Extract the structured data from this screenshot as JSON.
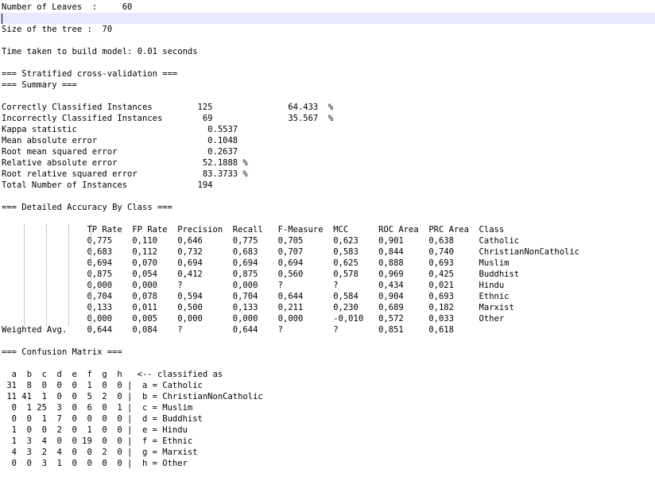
{
  "output": {
    "lines": [
      "Number of Leaves  :     60",
      "",
      "Size of the tree :  70",
      "",
      "Time taken to build model: 0.01 seconds",
      "",
      "=== Stratified cross-validation ===",
      "=== Summary ===",
      "",
      "Correctly Classified Instances         125               64.433  %",
      "Incorrectly Classified Instances        69               35.567  %",
      "Kappa statistic                          0.5537",
      "Mean absolute error                      0.1048",
      "Root mean squared error                  0.2637",
      "Relative absolute error                 52.1888 %",
      "Root relative squared error             83.3733 %",
      "Total Number of Instances              194",
      "",
      "=== Detailed Accuracy By Class ===",
      "",
      "                 TP Rate  FP Rate  Precision  Recall   F-Measure  MCC      ROC Area  PRC Area  Class",
      "                 0,775    0,110    0,646      0,775    0,705      0,623    0,901     0,638     Catholic",
      "                 0,683    0,112    0,732      0,683    0,707      0,583    0,844     0,740     ChristianNonCatholic",
      "                 0,694    0,070    0,694      0,694    0,694      0,625    0,888     0,693     Muslim",
      "                 0,875    0,054    0,412      0,875    0,560      0,578    0,969     0,425     Buddhist",
      "                 0,000    0,000    ?          0,000    ?          ?        0,434     0,021     Hindu",
      "                 0,704    0,078    0,594      0,704    0,644      0,584    0,904     0,693     Ethnic",
      "                 0,133    0,011    0,500      0,133    0,211      0,230    0,689     0,182     Marxist",
      "                 0,000    0,005    0,000      0,000    0,000      -0,010   0,572     0,033     Other",
      "Weighted Avg.    0,644    0,084    ?          0,644    ?          ?        0,851     0,618",
      "",
      "=== Confusion Matrix ===",
      "",
      "  a  b  c  d  e  f  g  h   <-- classified as",
      " 31  8  0  0  0  1  0  0 |  a = Catholic",
      " 11 41  1  0  0  5  2  0 |  b = ChristianNonCatholic",
      "  0  1 25  3  0  6  0  1 |  c = Muslim",
      "  0  0  1  7  0  0  0  0 |  d = Buddhist",
      "  1  0  0  2  0  1  0  0 |  e = Hindu",
      "  1  3  4  0  0 19  0  0 |  f = Ethnic",
      "  4  3  2  4  0  0  2  0 |  g = Marxist",
      "  0  0  3  1  0  0  0  0 |  h = Other"
    ]
  }
}
